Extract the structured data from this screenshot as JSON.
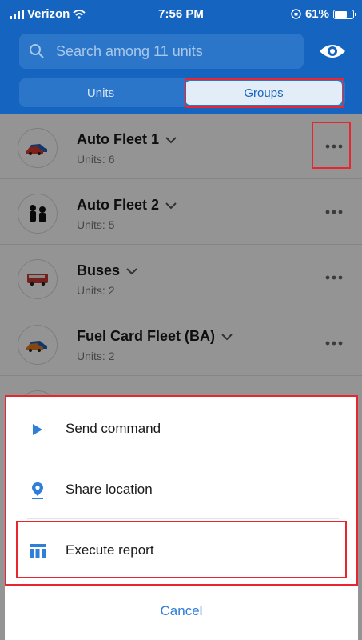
{
  "status_bar": {
    "carrier": "Verizon",
    "time": "7:56 PM",
    "battery": "61%"
  },
  "search": {
    "placeholder": "Search among 11 units"
  },
  "tabs": [
    {
      "label": "Units",
      "selected": false
    },
    {
      "label": "Groups",
      "selected": true
    }
  ],
  "groups": [
    {
      "name": "Auto Fleet 1",
      "units_label": "Units:",
      "units": "6",
      "icon": "car-icon"
    },
    {
      "name": "Auto Fleet 2",
      "units_label": "Units:",
      "units": "5",
      "icon": "people-icon"
    },
    {
      "name": "Buses",
      "units_label": "Units:",
      "units": "2",
      "icon": "bus-icon"
    },
    {
      "name": "Fuel Card Fleet (BA)",
      "units_label": "Units:",
      "units": "2",
      "icon": "car-icon"
    }
  ],
  "action_sheet": {
    "items": [
      {
        "label": "Send command",
        "icon": "play-icon"
      },
      {
        "label": "Share location",
        "icon": "location-pin-icon"
      },
      {
        "label": "Execute report",
        "icon": "report-table-icon"
      }
    ],
    "cancel_label": "Cancel"
  },
  "colors": {
    "header": "#1565c0",
    "accent": "#2f7ed8",
    "highlight": "#e8262f"
  }
}
